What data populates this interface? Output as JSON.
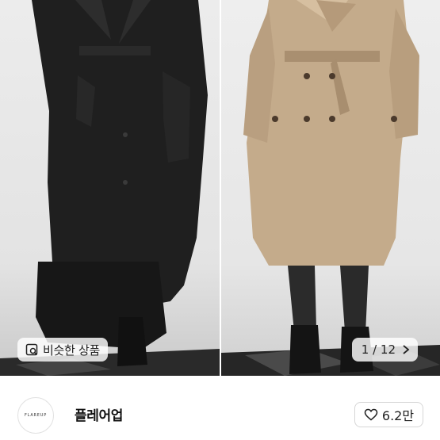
{
  "gallery": {
    "similar_products_label": "비슷한 상품",
    "page_indicator": "1 / 12",
    "current_page": 1,
    "total_pages": 12,
    "photos": [
      {
        "subject": "black trench coat",
        "color": "#1d1d1d"
      },
      {
        "subject": "beige trench coat",
        "color": "#c2a98a"
      }
    ]
  },
  "seller": {
    "avatar_text": "FLAREUP",
    "name": "플레어업"
  },
  "like": {
    "count_label": "6.2만"
  },
  "icons": {
    "similar": "similar-search-icon",
    "next": "chevron-right-icon",
    "like": "heart-outline-icon"
  }
}
